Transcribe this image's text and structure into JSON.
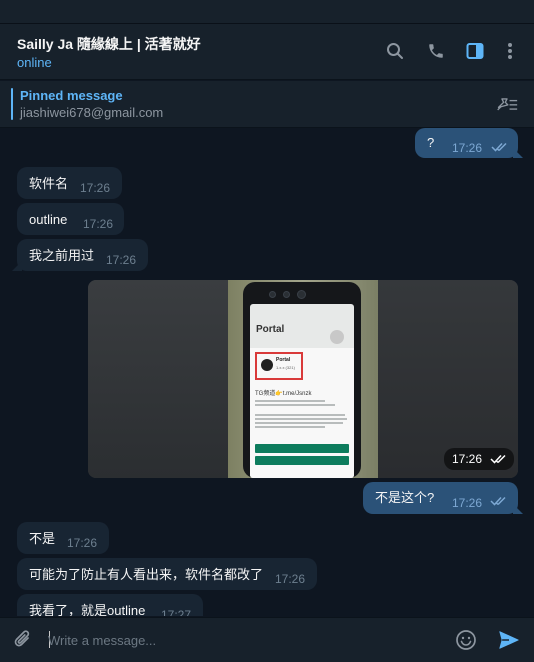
{
  "header": {
    "title": "Sailly Ja 隨緣線上 | 活著就好",
    "status": "online",
    "icons": [
      "search-icon",
      "phone-icon",
      "sidebar-toggle-icon",
      "more-vertical-icon"
    ]
  },
  "pinned": {
    "title": "Pinned message",
    "text": "jiashiwei678@gmail.com",
    "icon": "unpin-icon"
  },
  "messages": [
    {
      "dir": "out",
      "text": "?",
      "time": "17:26",
      "read": true
    },
    {
      "dir": "in",
      "text": "软件名",
      "time": "17:26"
    },
    {
      "dir": "in",
      "text": "outline",
      "time": "17:26"
    },
    {
      "dir": "in",
      "text": "我之前用过",
      "time": "17:26"
    },
    {
      "dir": "out",
      "type": "photo",
      "time": "17:26",
      "read": true,
      "photo_text": {
        "header": "Portal",
        "app_name": "Portal",
        "app_version": "1.x.x (321)",
        "promo": "TG频道👉t.me/Jsnzk"
      }
    },
    {
      "dir": "out",
      "text": "不是这个?",
      "time": "17:26",
      "read": true
    },
    {
      "dir": "in",
      "text": "不是",
      "time": "17:26"
    },
    {
      "dir": "in",
      "text": "可能为了防止有人看出来，软件名都改了",
      "time": "17:26"
    },
    {
      "dir": "in",
      "text": "我看了，就是outline",
      "time": "17:27"
    }
  ],
  "composer": {
    "placeholder": "Write a message...",
    "icons": [
      "attach-icon",
      "emoji-icon",
      "send-icon"
    ]
  },
  "colors": {
    "background": "#0e1621",
    "panel": "#17212b",
    "incoming_bubble": "#182533",
    "outgoing_bubble": "#2b5278",
    "accent": "#5eb5f7"
  }
}
